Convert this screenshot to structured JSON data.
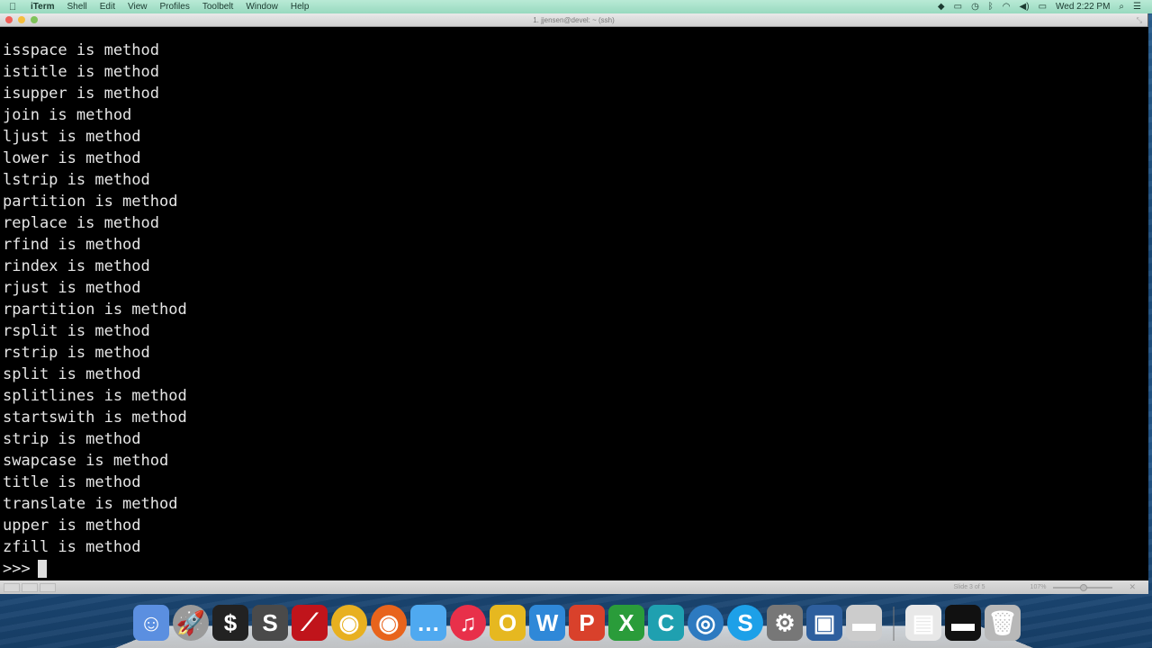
{
  "menubar": {
    "apple_icon": "",
    "app_name": "iTerm",
    "items": [
      "Shell",
      "Edit",
      "View",
      "Profiles",
      "Toolbelt",
      "Window",
      "Help"
    ],
    "status_icons": [
      {
        "name": "dropbox-icon",
        "glyph": "◆"
      },
      {
        "name": "airplay-icon",
        "glyph": "▭"
      },
      {
        "name": "time-machine-icon",
        "glyph": "◷"
      },
      {
        "name": "bluetooth-icon",
        "glyph": "ᛒ"
      },
      {
        "name": "wifi-icon",
        "glyph": "◠"
      },
      {
        "name": "volume-icon",
        "glyph": "◀)"
      },
      {
        "name": "battery-icon",
        "glyph": "▭"
      }
    ],
    "clock": "Wed 2:22 PM",
    "spotlight_icon": "⌕",
    "notifications_icon": "☰"
  },
  "window": {
    "title": "1. jjensen@devel: ~ (ssh)",
    "resize_glyph": "⤡"
  },
  "terminal": {
    "lines": [
      "isspace is method",
      "istitle is method",
      "isupper is method",
      "join is method",
      "ljust is method",
      "lower is method",
      "lstrip is method",
      "partition is method",
      "replace is method",
      "rfind is method",
      "rindex is method",
      "rjust is method",
      "rpartition is method",
      "rsplit is method",
      "rstrip is method",
      "split is method",
      "splitlines is method",
      "startswith is method",
      "strip is method",
      "swapcase is method",
      "title is method",
      "translate is method",
      "upper is method",
      "zfill is method"
    ],
    "prompt": ">>>"
  },
  "statusbar": {
    "slide_info": "Slide 3 of 5",
    "zoom_level": "107%",
    "fit_icon": "✕"
  },
  "dock": {
    "items": [
      {
        "name": "finder",
        "label": "☺",
        "color": "#5b8fe0"
      },
      {
        "name": "launchpad",
        "label": "🚀",
        "color": "#9a9a9a"
      },
      {
        "name": "terminal",
        "label": "$",
        "color": "#222222"
      },
      {
        "name": "sublime-text",
        "label": "S",
        "color": "#4a4a4a"
      },
      {
        "name": "filezilla",
        "label": "⟋",
        "color": "#c0141b"
      },
      {
        "name": "chrome",
        "label": "◉",
        "color": "#e8b020"
      },
      {
        "name": "firefox",
        "label": "◉",
        "color": "#e8641c"
      },
      {
        "name": "messages",
        "label": "…",
        "color": "#4fa9f0"
      },
      {
        "name": "itunes",
        "label": "♫",
        "color": "#e8304a"
      },
      {
        "name": "outlook",
        "label": "O",
        "color": "#e6b820"
      },
      {
        "name": "word",
        "label": "W",
        "color": "#2f88d8"
      },
      {
        "name": "powerpoint",
        "label": "P",
        "color": "#d9412b"
      },
      {
        "name": "excel",
        "label": "X",
        "color": "#2a9c3a"
      },
      {
        "name": "code-app",
        "label": "C",
        "color": "#1fa0b0"
      },
      {
        "name": "network-app",
        "label": "◎",
        "color": "#2d7ac0"
      },
      {
        "name": "skype",
        "label": "S",
        "color": "#1da0e8"
      },
      {
        "name": "system-preferences",
        "label": "⚙",
        "color": "#777777"
      },
      {
        "name": "virtualbox",
        "label": "▣",
        "color": "#2e5f9e"
      },
      {
        "name": "display-app",
        "label": "▬",
        "color": "#cccccc"
      }
    ],
    "right_items": [
      {
        "name": "virtualbox-window-1",
        "label": "▤",
        "color": "#e8e8e8"
      },
      {
        "name": "virtualbox-window-2",
        "label": "▬",
        "color": "#111111"
      },
      {
        "name": "trash",
        "label": "🗑",
        "color": "#b8b8b8"
      }
    ]
  }
}
